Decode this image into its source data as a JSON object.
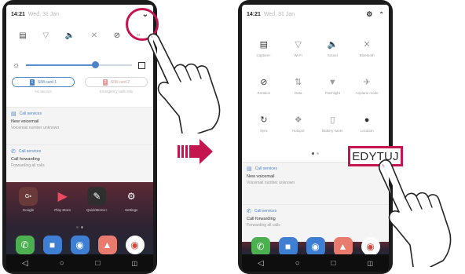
{
  "left_phone": {
    "status": {
      "time": "14:21",
      "date": "Wed, 31 Jan"
    },
    "quick_settings": [
      {
        "icon": "screen-rotation-icon"
      },
      {
        "icon": "wifi-off-icon"
      },
      {
        "icon": "sound-icon"
      },
      {
        "icon": "bluetooth-icon"
      },
      {
        "icon": "do-not-disturb-icon"
      }
    ],
    "brightness_level": 0.65,
    "sim_cards": [
      {
        "label": "SIM card 1",
        "sub": "No service",
        "active": true,
        "badge": "1",
        "color": "#4b82c8"
      },
      {
        "label": "SIM card 2",
        "sub": "Emergency calls only",
        "active": false,
        "badge": "2",
        "color": "#e89a9a"
      }
    ],
    "notifications": [
      {
        "app": "Call services",
        "title": "New voicemail",
        "text": "Voicemail number unknown"
      },
      {
        "app": "Call services",
        "title": "Call forwarding",
        "text": "Forwarding all calls"
      }
    ],
    "apps": [
      {
        "label": "Google",
        "icon": "google-folder-icon",
        "color": "#6a3a3a"
      },
      {
        "label": "Play Store",
        "icon": "play-store-icon",
        "color": "#3a3a3a"
      },
      {
        "label": "QuickMemo+",
        "icon": "pen-icon",
        "color": "#2f2f2f"
      },
      {
        "label": "Settings",
        "icon": "gear-icon",
        "color": "#3a3a3a"
      }
    ],
    "dock": [
      {
        "icon": "phone-icon",
        "color": "#4caf50"
      },
      {
        "icon": "messages-icon",
        "color": "#3f7fd3"
      },
      {
        "icon": "camera-icon",
        "color": "#3f7fd3"
      },
      {
        "icon": "gallery-icon",
        "color": "#e97b6e"
      },
      {
        "icon": "chrome-icon",
        "color": "#ffffff"
      }
    ]
  },
  "right_phone": {
    "status": {
      "time": "14:21",
      "date": "Wed, 31 Jan"
    },
    "tile_rows": [
      [
        {
          "label": "Capture+",
          "icon": "screen-rotation-icon",
          "dim": false
        },
        {
          "label": "Wi-Fi",
          "icon": "wifi-off-icon",
          "dim": true
        },
        {
          "label": "Sound",
          "icon": "sound-icon",
          "dim": false
        },
        {
          "label": "Bluetooth",
          "icon": "bluetooth-icon",
          "dim": true
        }
      ],
      [
        {
          "label": "Rotation",
          "icon": "do-not-disturb-icon",
          "dim": false
        },
        {
          "label": "Data",
          "icon": "data-off-icon",
          "dim": true
        },
        {
          "label": "Flashlight",
          "icon": "flashlight-icon",
          "dim": true
        },
        {
          "label": "Airplane mode",
          "icon": "airplane-icon",
          "dim": true
        }
      ],
      [
        {
          "label": "Sync",
          "icon": "sync-icon",
          "dim": false
        },
        {
          "label": "Hotspot",
          "icon": "hotspot-icon",
          "dim": true
        },
        {
          "label": "Battery saver",
          "icon": "battery-saver-icon",
          "dim": true
        },
        {
          "label": "Location",
          "icon": "location-icon",
          "dim": false
        }
      ]
    ],
    "notifications": [
      {
        "app": "Call services",
        "title": "New voicemail",
        "text": "Voicemail number unknown"
      },
      {
        "app": "Call services",
        "title": "Call forwarding",
        "text": "Forwarding all calls"
      }
    ]
  },
  "edit_label": "EDYTUJ",
  "accent_color": "#c3164f"
}
